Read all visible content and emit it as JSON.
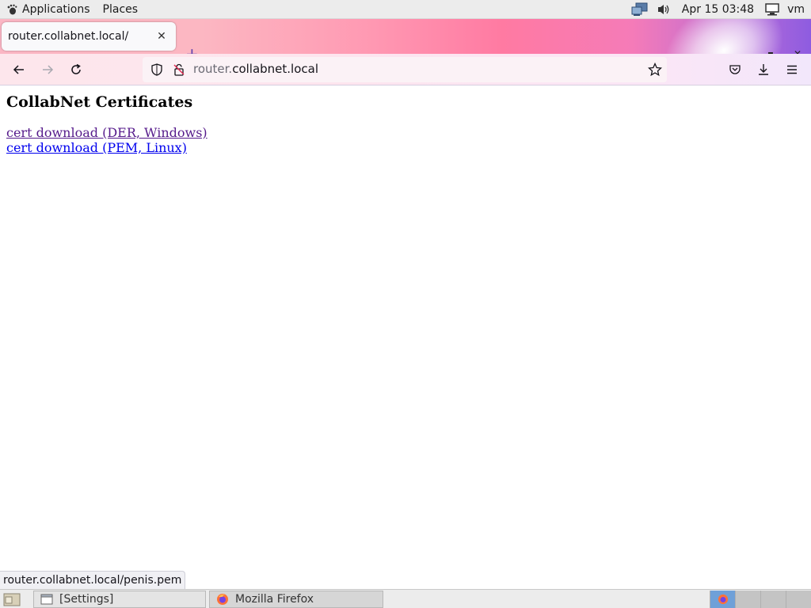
{
  "top_panel": {
    "applications": "Applications",
    "places": "Places",
    "clock": "Apr 15  03:48",
    "user": "vm"
  },
  "browser": {
    "tab_title": "router.collabnet.local/",
    "url_sub": "router.",
    "url_domain": "collabnet.local",
    "accent": "#5b3fae"
  },
  "page": {
    "heading": "CollabNet Certificates",
    "links": [
      {
        "label": "cert download (DER, Windows)",
        "state": "visited"
      },
      {
        "label": "cert download (PEM, Linux)",
        "state": "unvisited"
      }
    ],
    "status_url": "router.collabnet.local/penis.pem"
  },
  "taskbar": {
    "tasks": [
      {
        "label": "[Settings]",
        "icon": "window-icon"
      },
      {
        "label": "Mozilla Firefox",
        "icon": "firefox-icon"
      }
    ]
  }
}
